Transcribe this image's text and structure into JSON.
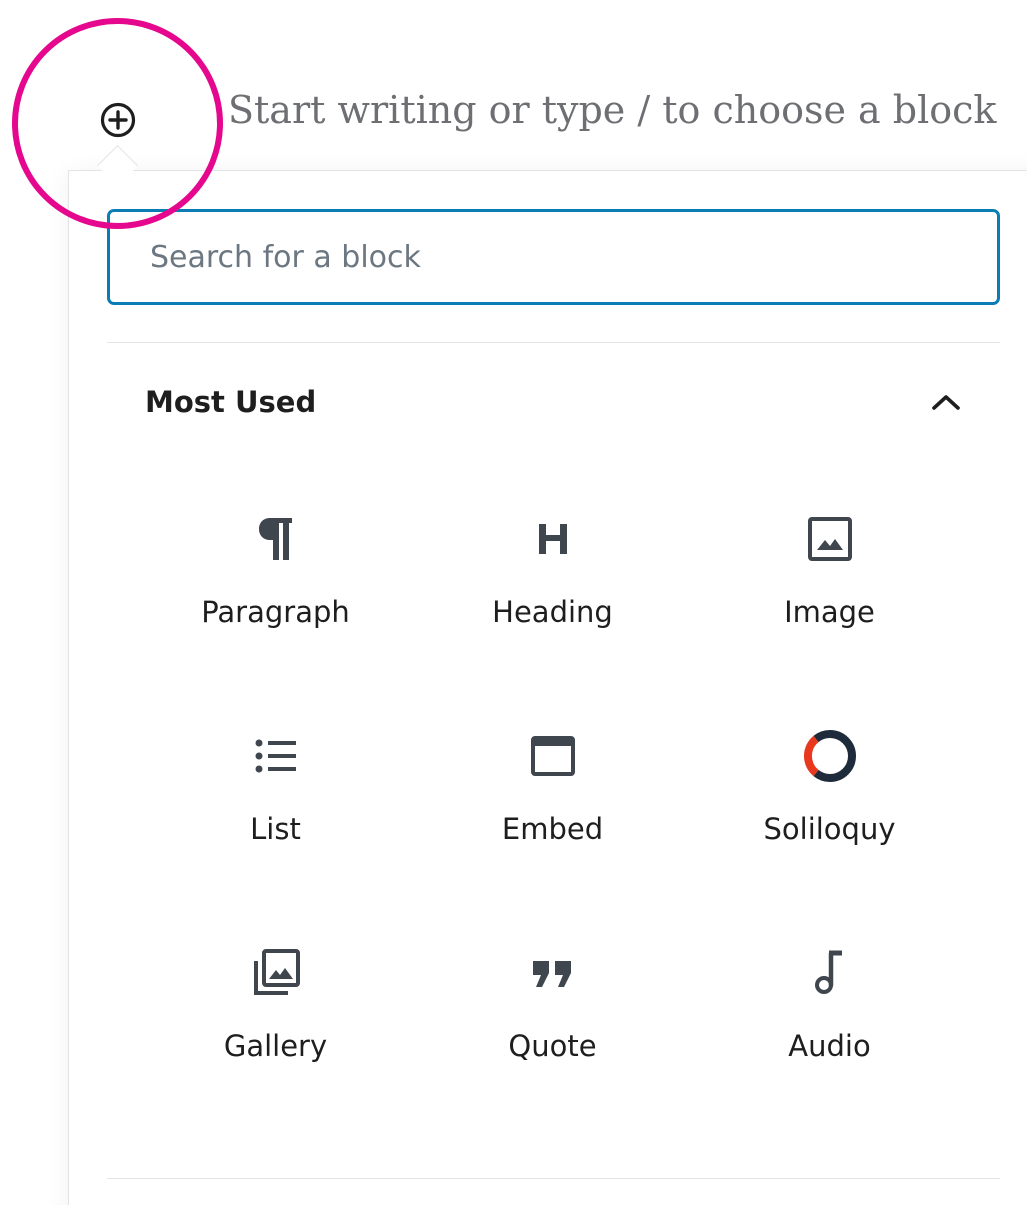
{
  "editor": {
    "placeholder": "Start writing or type / to choose a block",
    "add_block_icon": "plus-circle-icon"
  },
  "highlight": {
    "color": "#e5088e"
  },
  "inserter": {
    "search": {
      "placeholder": "Search for a block",
      "value": "",
      "border_color": "#0b7db4"
    },
    "section": {
      "title": "Most Used",
      "toggle_icon": "chevron-up-icon",
      "expanded": true
    },
    "blocks": [
      {
        "label": "Paragraph",
        "icon": "paragraph-icon"
      },
      {
        "label": "Heading",
        "icon": "heading-icon"
      },
      {
        "label": "Image",
        "icon": "image-icon"
      },
      {
        "label": "List",
        "icon": "list-icon"
      },
      {
        "label": "Embed",
        "icon": "embed-icon"
      },
      {
        "label": "Soliloquy",
        "icon": "soliloquy-icon"
      },
      {
        "label": "Gallery",
        "icon": "gallery-icon"
      },
      {
        "label": "Quote",
        "icon": "quote-icon"
      },
      {
        "label": "Audio",
        "icon": "audio-icon"
      }
    ],
    "soliloquy_colors": {
      "dark": "#1d2b3a",
      "accent": "#e8391e"
    }
  }
}
